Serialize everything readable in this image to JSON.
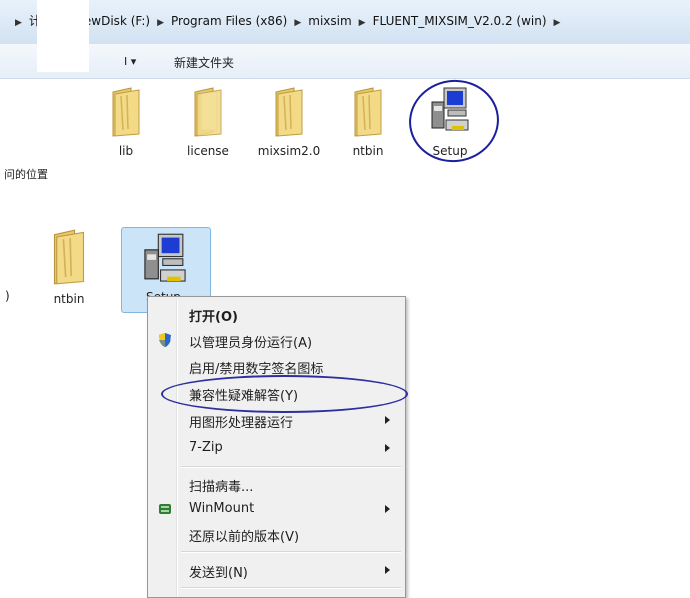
{
  "address_bar": {
    "crumbs": [
      "计",
      "NewDisk (F:)",
      "Program Files (x86)",
      "mixsim",
      "FLUENT_MIXSIM_V2.0.2 (win)"
    ]
  },
  "toolbar": {
    "organize_fragment": "I ▾",
    "new_folder": "新建文件夹"
  },
  "sidebar": {
    "recent_places_fragment": "问的位置"
  },
  "top_files": [
    {
      "label": "lib",
      "icon": "folder-icon"
    },
    {
      "label": "license",
      "icon": "folder-icon"
    },
    {
      "label": "mixsim2.0",
      "icon": "folder-icon"
    },
    {
      "label": "ntbin",
      "icon": "folder-icon"
    },
    {
      "label": "Setup",
      "icon": "setup-installer-icon"
    }
  ],
  "bottom_files": [
    {
      "label": ")"
    },
    {
      "label": "ntbin",
      "icon": "folder-icon"
    },
    {
      "label": "Setup",
      "icon": "setup-installer-icon"
    }
  ],
  "context_menu": {
    "items": [
      {
        "label": "打开(O)",
        "bold": true
      },
      {
        "label": "以管理员身份运行(A)",
        "icon": "uac-shield-icon"
      },
      {
        "label": "启用/禁用数字签名图标"
      },
      {
        "label": "兼容性疑难解答(Y)"
      },
      {
        "label": "用图形处理器运行",
        "submenu": true
      },
      {
        "label": "7-Zip",
        "submenu": true
      },
      {
        "label": "扫描病毒..."
      },
      {
        "label": "WinMount",
        "icon": "winmount-icon",
        "submenu": true
      },
      {
        "label": "还原以前的版本(V)"
      },
      {
        "label": "发送到(N)",
        "submenu": true
      }
    ]
  },
  "colors": {
    "annotation_circle": "#1b1f9c",
    "selection_fill": "#cce4f7",
    "menu_bg": "#f0f0f0"
  }
}
